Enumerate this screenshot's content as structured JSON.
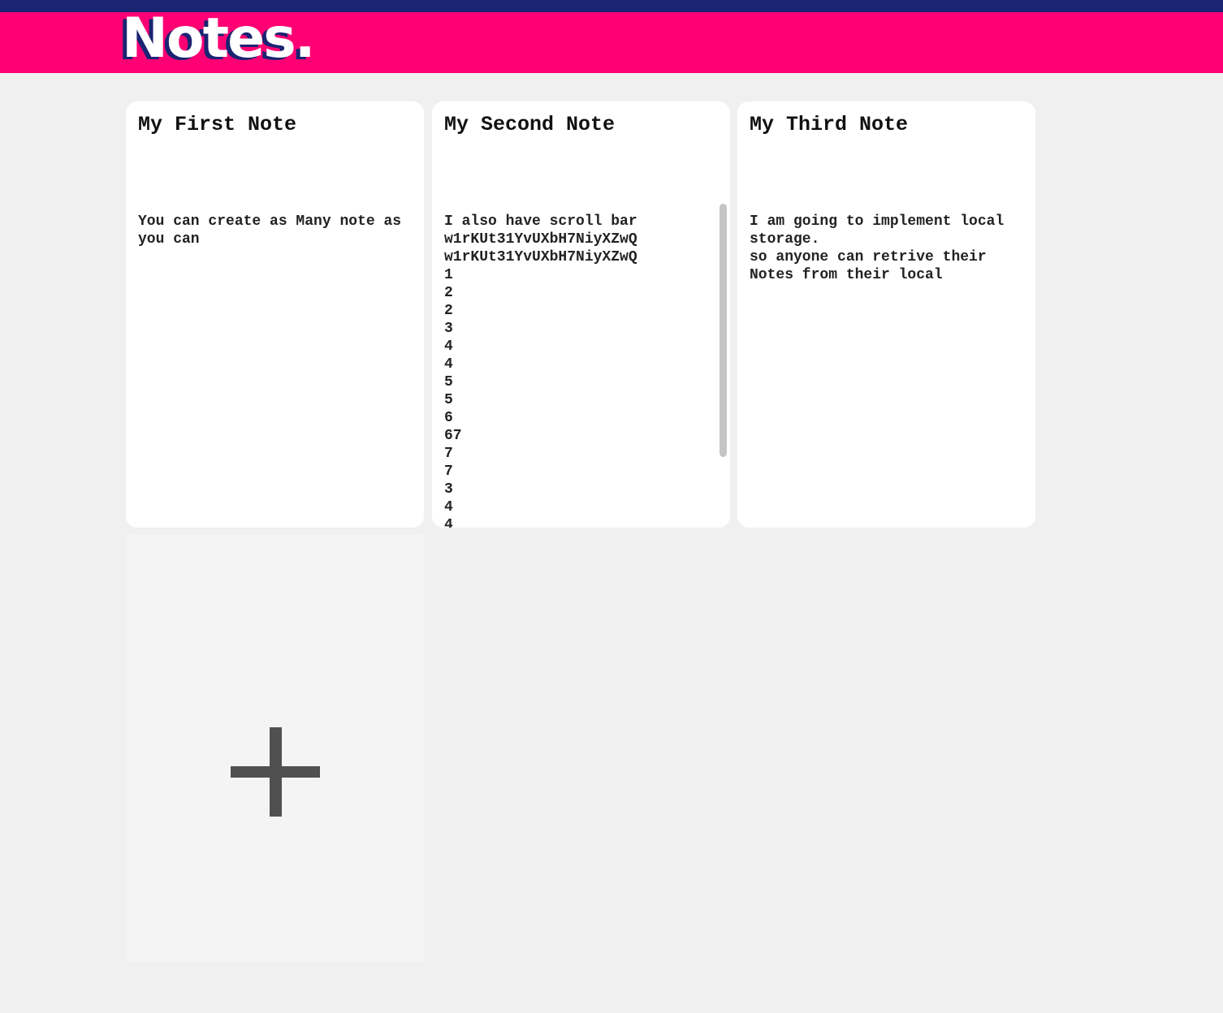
{
  "app": {
    "logo": "Notes."
  },
  "notes": [
    {
      "title": "My First Note",
      "body": "You can create as Many note as you can"
    },
    {
      "title": "My Second Note",
      "body": "I also have scroll bar\nw1rKUt31YvUXbH7NiyXZwQ\nw1rKUt31YvUXbH7NiyXZwQ\n1\n2\n2\n3\n4\n4\n5\n5\n6\n67\n7\n7\n3\n4\n4"
    },
    {
      "title": "My Third Note",
      "body": "I am going to implement local storage.\nso anyone can retrive their Notes from their local"
    }
  ],
  "add_note": {
    "icon": "plus-icon"
  },
  "colors": {
    "topbar": "#1a2472",
    "header": "#ff0074",
    "background": "#f0f0f0",
    "card": "#ffffff",
    "add_card": "#f4f4f4",
    "plus": "#505050"
  }
}
